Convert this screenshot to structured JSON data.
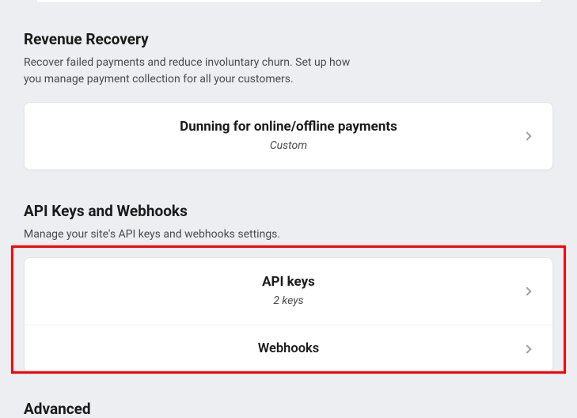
{
  "revenue_recovery": {
    "title": "Revenue Recovery",
    "description": "Recover failed payments and reduce involuntary churn. Set up how you manage payment collection for all your customers.",
    "card": {
      "title": "Dunning for online/offline payments",
      "subtitle": "Custom"
    }
  },
  "api_section": {
    "title": "API Keys and Webhooks",
    "description": "Manage your site's API keys and webhooks settings.",
    "items": [
      {
        "title": "API keys",
        "subtitle": "2 keys"
      },
      {
        "title": "Webhooks"
      }
    ]
  },
  "advanced": {
    "title": "Advanced"
  }
}
